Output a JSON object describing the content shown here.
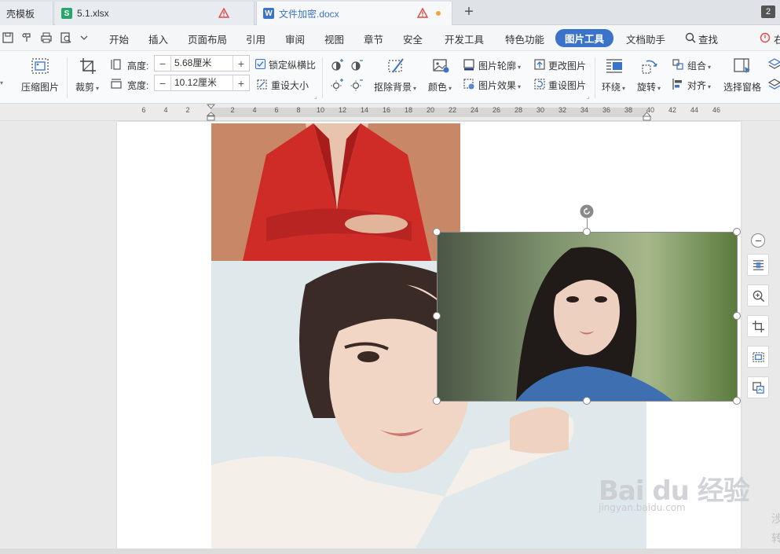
{
  "tabs": {
    "items": [
      {
        "label": "壳模板",
        "icon": "template-icon"
      },
      {
        "label": "5.1.xlsx",
        "icon": "spreadsheet-icon",
        "icon_letter": "S",
        "warning": true
      },
      {
        "label": "文件加密.docx",
        "icon": "document-icon",
        "icon_letter": "W",
        "warning": true,
        "unsaved": true,
        "active": true
      }
    ],
    "new_tab_symbol": "+",
    "window_count": "2"
  },
  "menu": {
    "items": [
      "开始",
      "插入",
      "页面布局",
      "引用",
      "审阅",
      "视图",
      "章节",
      "安全",
      "开发工具",
      "特色功能",
      "图片工具",
      "文档助手",
      "查找"
    ],
    "active": "图片工具",
    "right_cut": "右"
  },
  "ribbon": {
    "compress": "压缩图片",
    "crop": "裁剪",
    "height_label": "高度:",
    "height_value": "5.68厘米",
    "width_label": "宽度:",
    "width_value": "10.12厘米",
    "lock_ratio": "锁定纵横比",
    "reset_size": "重设大小",
    "remove_bg": "抠除背景",
    "color": "颜色",
    "outline": "图片轮廓",
    "effects": "图片效果",
    "change_pic": "更改图片",
    "reset_pic": "重设图片",
    "wrap": "环绕",
    "rotate": "旋转",
    "group": "组合",
    "align": "对齐",
    "select_pane": "选择窗格"
  },
  "ruler": {
    "left_ticks": [
      "6",
      "4",
      "2"
    ],
    "right_ticks": [
      "2",
      "4",
      "6",
      "8",
      "10",
      "12",
      "14",
      "16",
      "18",
      "20",
      "22",
      "24",
      "26",
      "28",
      "30",
      "32",
      "34",
      "36",
      "38",
      "40",
      "42",
      "44",
      "46"
    ]
  },
  "watermark": {
    "main": "Bai du 经验",
    "sub": "jingyan.baidu.com"
  },
  "edge_text": [
    "涉",
    "转"
  ],
  "colors": {
    "accent": "#3a73c9",
    "warning": "#e04848",
    "unsaved_dot": "#f3a440"
  }
}
